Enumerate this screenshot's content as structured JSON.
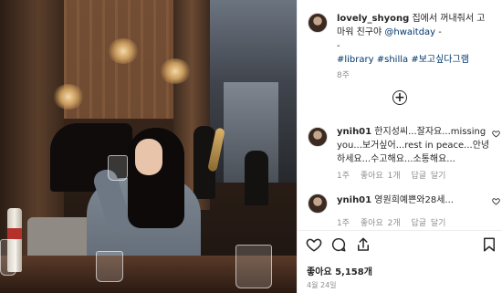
{
  "post": {
    "username": "lovely_shyong",
    "caption_text": " 집에서 꺼내줘서 고마워 친구야 ",
    "mention": "@hwaitday",
    "caption_sep": " -",
    "caption_dash": "-",
    "tags": [
      "#library",
      "#shilla",
      "#보고싶다그램"
    ],
    "time": "8주"
  },
  "comments": [
    {
      "username": "ynih01",
      "text": " 한지성씨...잘자요...missing you...보거싶어...rest in peace...안녕하세요...수고해요...소통해요...",
      "time": "1주",
      "likes": "좋아요 1개",
      "reply": "답글 달기"
    },
    {
      "username": "ynih01",
      "text": " 영원희예쁜와28세...",
      "time": "1주",
      "likes": "좋아요 2개",
      "reply": "답글 달기"
    }
  ],
  "actions": {
    "like_icon": "heart-icon",
    "comment_icon": "comment-icon",
    "share_icon": "share-icon",
    "save_icon": "bookmark-icon",
    "more_icon": "plus-circle-icon"
  },
  "stats": {
    "likes": "좋아요 5,158개",
    "date": "4월 24일"
  },
  "colors": {
    "link": "#00376b",
    "muted": "#8e8e8e",
    "text": "#262626"
  }
}
